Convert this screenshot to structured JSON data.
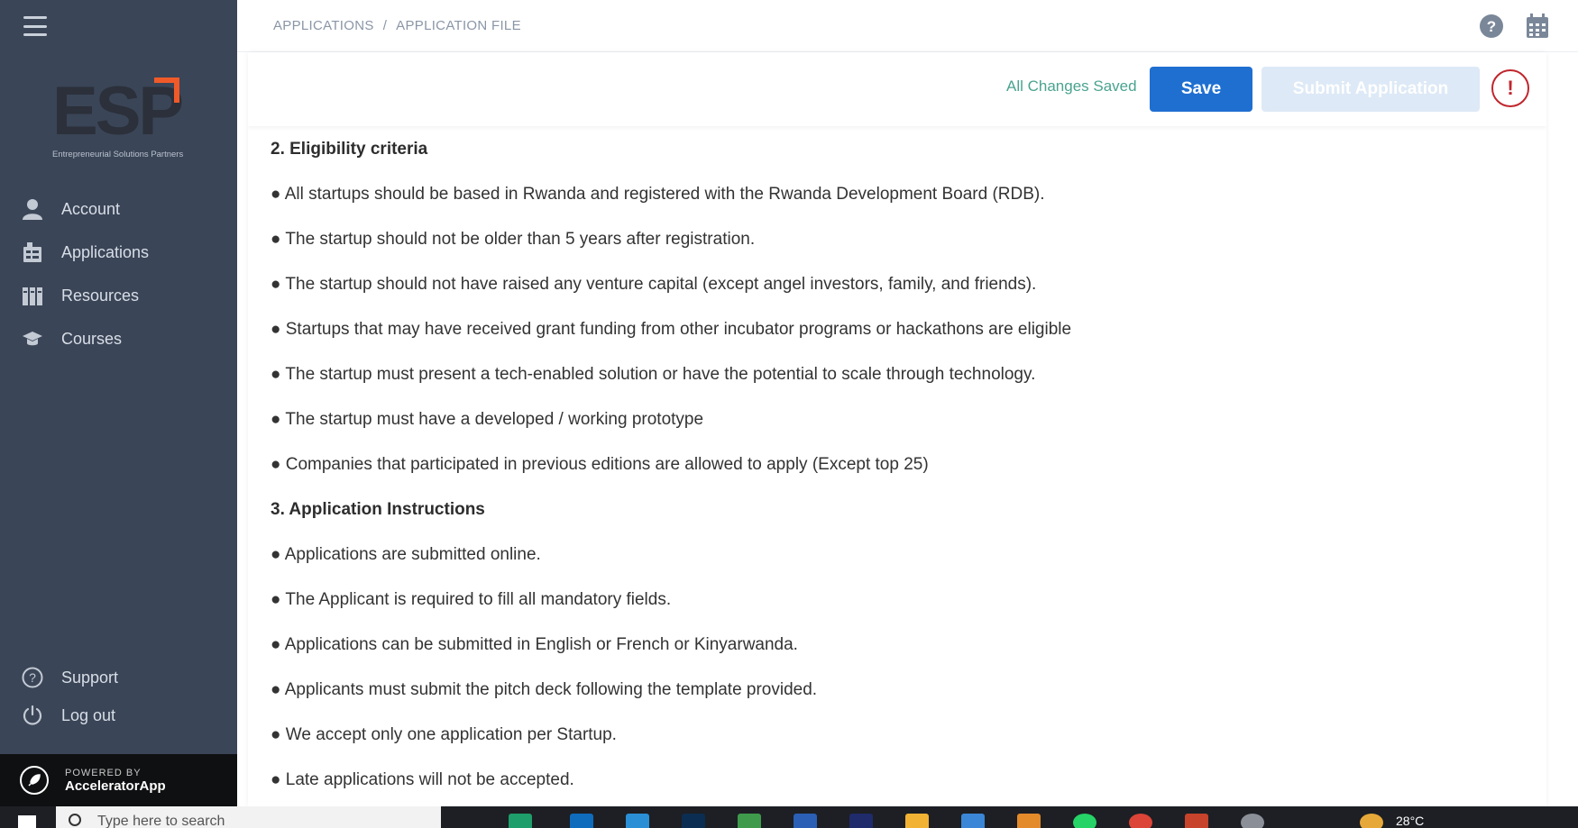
{
  "sidebar": {
    "logo_text": "ESP",
    "logo_tagline": "Entrepreneurial Solutions Partners",
    "nav": [
      {
        "label": "Account",
        "icon": "user-icon"
      },
      {
        "label": "Applications",
        "icon": "applications-icon"
      },
      {
        "label": "Resources",
        "icon": "books-icon"
      },
      {
        "label": "Courses",
        "icon": "graduation-cap-icon"
      }
    ],
    "bottom_nav": [
      {
        "label": "Support",
        "icon": "question-circle-icon"
      },
      {
        "label": "Log out",
        "icon": "power-icon"
      }
    ],
    "powered_by": {
      "small": "POWERED BY",
      "name": "AcceleratorApp"
    }
  },
  "header": {
    "breadcrumb": [
      "APPLICATIONS",
      "APPLICATION FILE"
    ],
    "separator": "/",
    "icons": [
      "help-icon",
      "calendar-icon"
    ]
  },
  "actions": {
    "status": "All Changes Saved",
    "save_label": "Save",
    "submit_label": "Submit Application",
    "alert_symbol": "!"
  },
  "document": {
    "sections": [
      {
        "heading": "2. Eligibility criteria",
        "items": [
          "● All startups should be based in Rwanda and registered with the Rwanda Development Board (RDB).",
          "● The startup should not be older than 5 years after registration.",
          "● The startup should not have raised any venture capital (except angel investors, family, and friends).",
          "● Startups that may have received grant funding from other incubator programs or hackathons are eligible",
          "● The startup must present a tech-enabled solution or have the potential to scale through technology.",
          "● The startup must have a developed / working prototype",
          "● Companies that participated in previous editions are allowed to apply (Except top 25)"
        ]
      },
      {
        "heading": "3. Application Instructions",
        "items": [
          "● Applications are submitted online.",
          "● The Applicant is required to fill all mandatory fields.",
          "● Applications can be submitted in English or French or Kinyarwanda.",
          "● Applicants must submit the pitch deck following the template provided.",
          "● We accept only one application per Startup.",
          "● Late applications will not be accepted."
        ]
      }
    ]
  },
  "taskbar": {
    "search_placeholder": "Type here to search",
    "temperature": "28°C"
  },
  "colors": {
    "sidebar_bg": "#3a4557",
    "accent_orange": "#f05a28",
    "save_blue": "#1f6fd1",
    "submit_disabled": "#dde9f6",
    "saved_green": "#4aa38f",
    "alert_red": "#c0262d"
  }
}
